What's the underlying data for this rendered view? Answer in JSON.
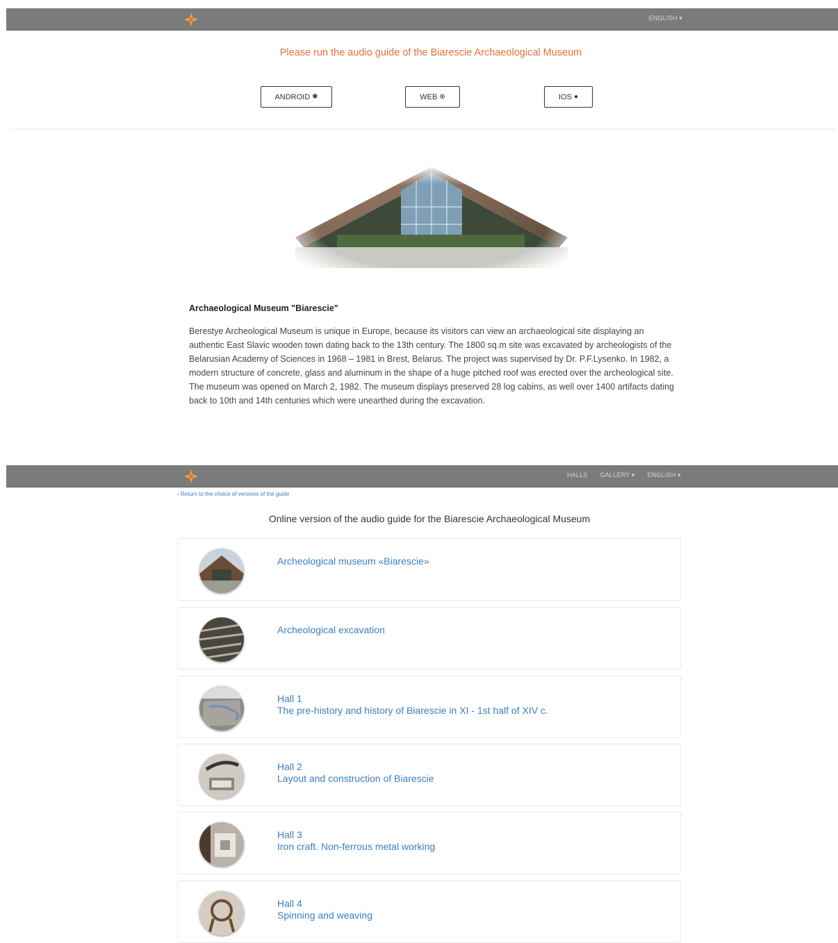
{
  "top_nav": {
    "language": "ENGLISH ▾"
  },
  "landing": {
    "title": "Please run the audio guide of the Biarescie Archaeological Museum",
    "buttons": [
      {
        "label": "ANDROID",
        "icon": "android-icon"
      },
      {
        "label": "WEB",
        "icon": "globe-icon"
      },
      {
        "label": "IOS",
        "icon": "apple-icon"
      }
    ],
    "about_title": "Archaeological Museum \"Biarescie\"",
    "about_text": "Berestye Archeological Museum is unique in Europe, because its visitors can view an archaeological site displaying an authentic East Slavic wooden town dating back to the 13th century. The 1800 sq.m site was excavated by archeologists of the Belarusian Academy of Sciences in 1968 – 1981 in Brest, Belarus. The project was supervised by Dr. P.F.Lysenko. In 1982, a modern structure of concrete, glass and aluminum in the shape of a huge pitched roof was erected over the archeological site. The museum was opened on March 2, 1982. The museum displays preserved 28 log cabins, as well over 1400 artifacts dating back to 10th and 14th centuries which were unearthed during the excavation."
  },
  "guide_nav": {
    "halls": "HALLS",
    "gallery": "GALLERY ▾",
    "language": "ENGLISH ▾"
  },
  "guide": {
    "back_link": "‹ Return to the choice of versions of the guide",
    "title": "Online version of the audio guide for the Biarescie Archaeological Museum",
    "items": [
      {
        "line1": "Archeological museum «Biarescie»",
        "line2": ""
      },
      {
        "line1": "Archeological excavation",
        "line2": ""
      },
      {
        "line1": "Hall 1",
        "line2": "The pre-history and history of Biarescie in XI - 1st half of XIV c."
      },
      {
        "line1": "Hall 2",
        "line2": "Layout and construction of Biarescie"
      },
      {
        "line1": "Hall 3",
        "line2": "Iron craft. Non-ferrous metal working"
      },
      {
        "line1": "Hall 4",
        "line2": "Spinning and weaving"
      }
    ]
  },
  "colors": {
    "navbar": "#7b7b7b",
    "accent_orange": "#e8703a",
    "link_blue": "#3a7fc3"
  }
}
